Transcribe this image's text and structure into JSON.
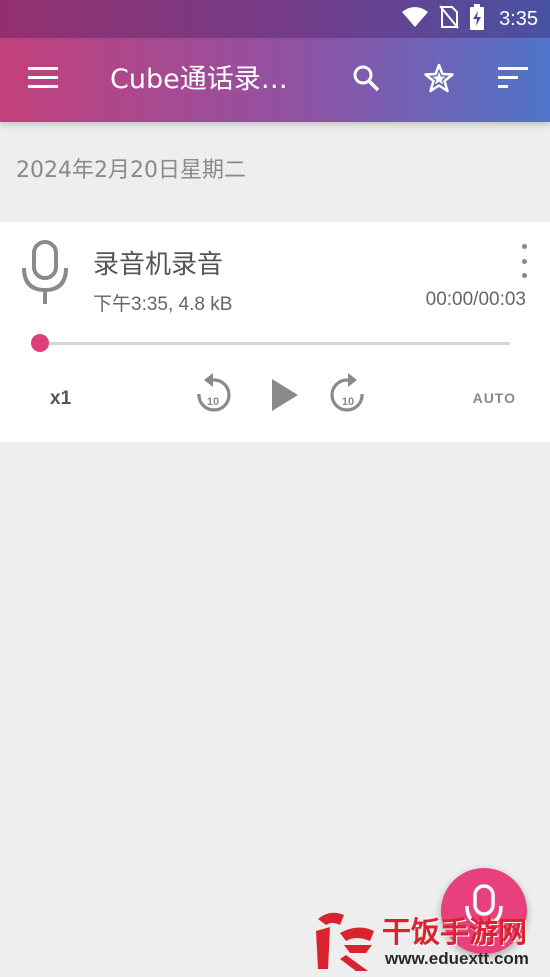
{
  "status_bar": {
    "time": "3:35",
    "icons": [
      "wifi-icon",
      "no-sim-icon",
      "battery-charging-icon"
    ]
  },
  "toolbar": {
    "title": "Cube通话录…",
    "icons": [
      "menu-icon",
      "search-icon",
      "star-icon",
      "sort-icon"
    ]
  },
  "list": {
    "date_header": "2024年2月20日星期二",
    "recordings": [
      {
        "title": "录音机录音",
        "subtitle": "下午3:35, 4.8 kB",
        "duration": "00:00/00:03",
        "progress": 0,
        "speed": "x1",
        "auto_label": "AUTO",
        "rewind_seconds": "10",
        "forward_seconds": "10"
      }
    ]
  },
  "fab": {
    "icon": "microphone-icon"
  },
  "watermark": {
    "main": "干饭手游网",
    "sub": "www.eduextt.com"
  },
  "colors": {
    "accent": "#e8407c",
    "toolbar_gradient_start": "#c2407b",
    "toolbar_gradient_end": "#4f74c9",
    "background": "#eeeeee"
  }
}
